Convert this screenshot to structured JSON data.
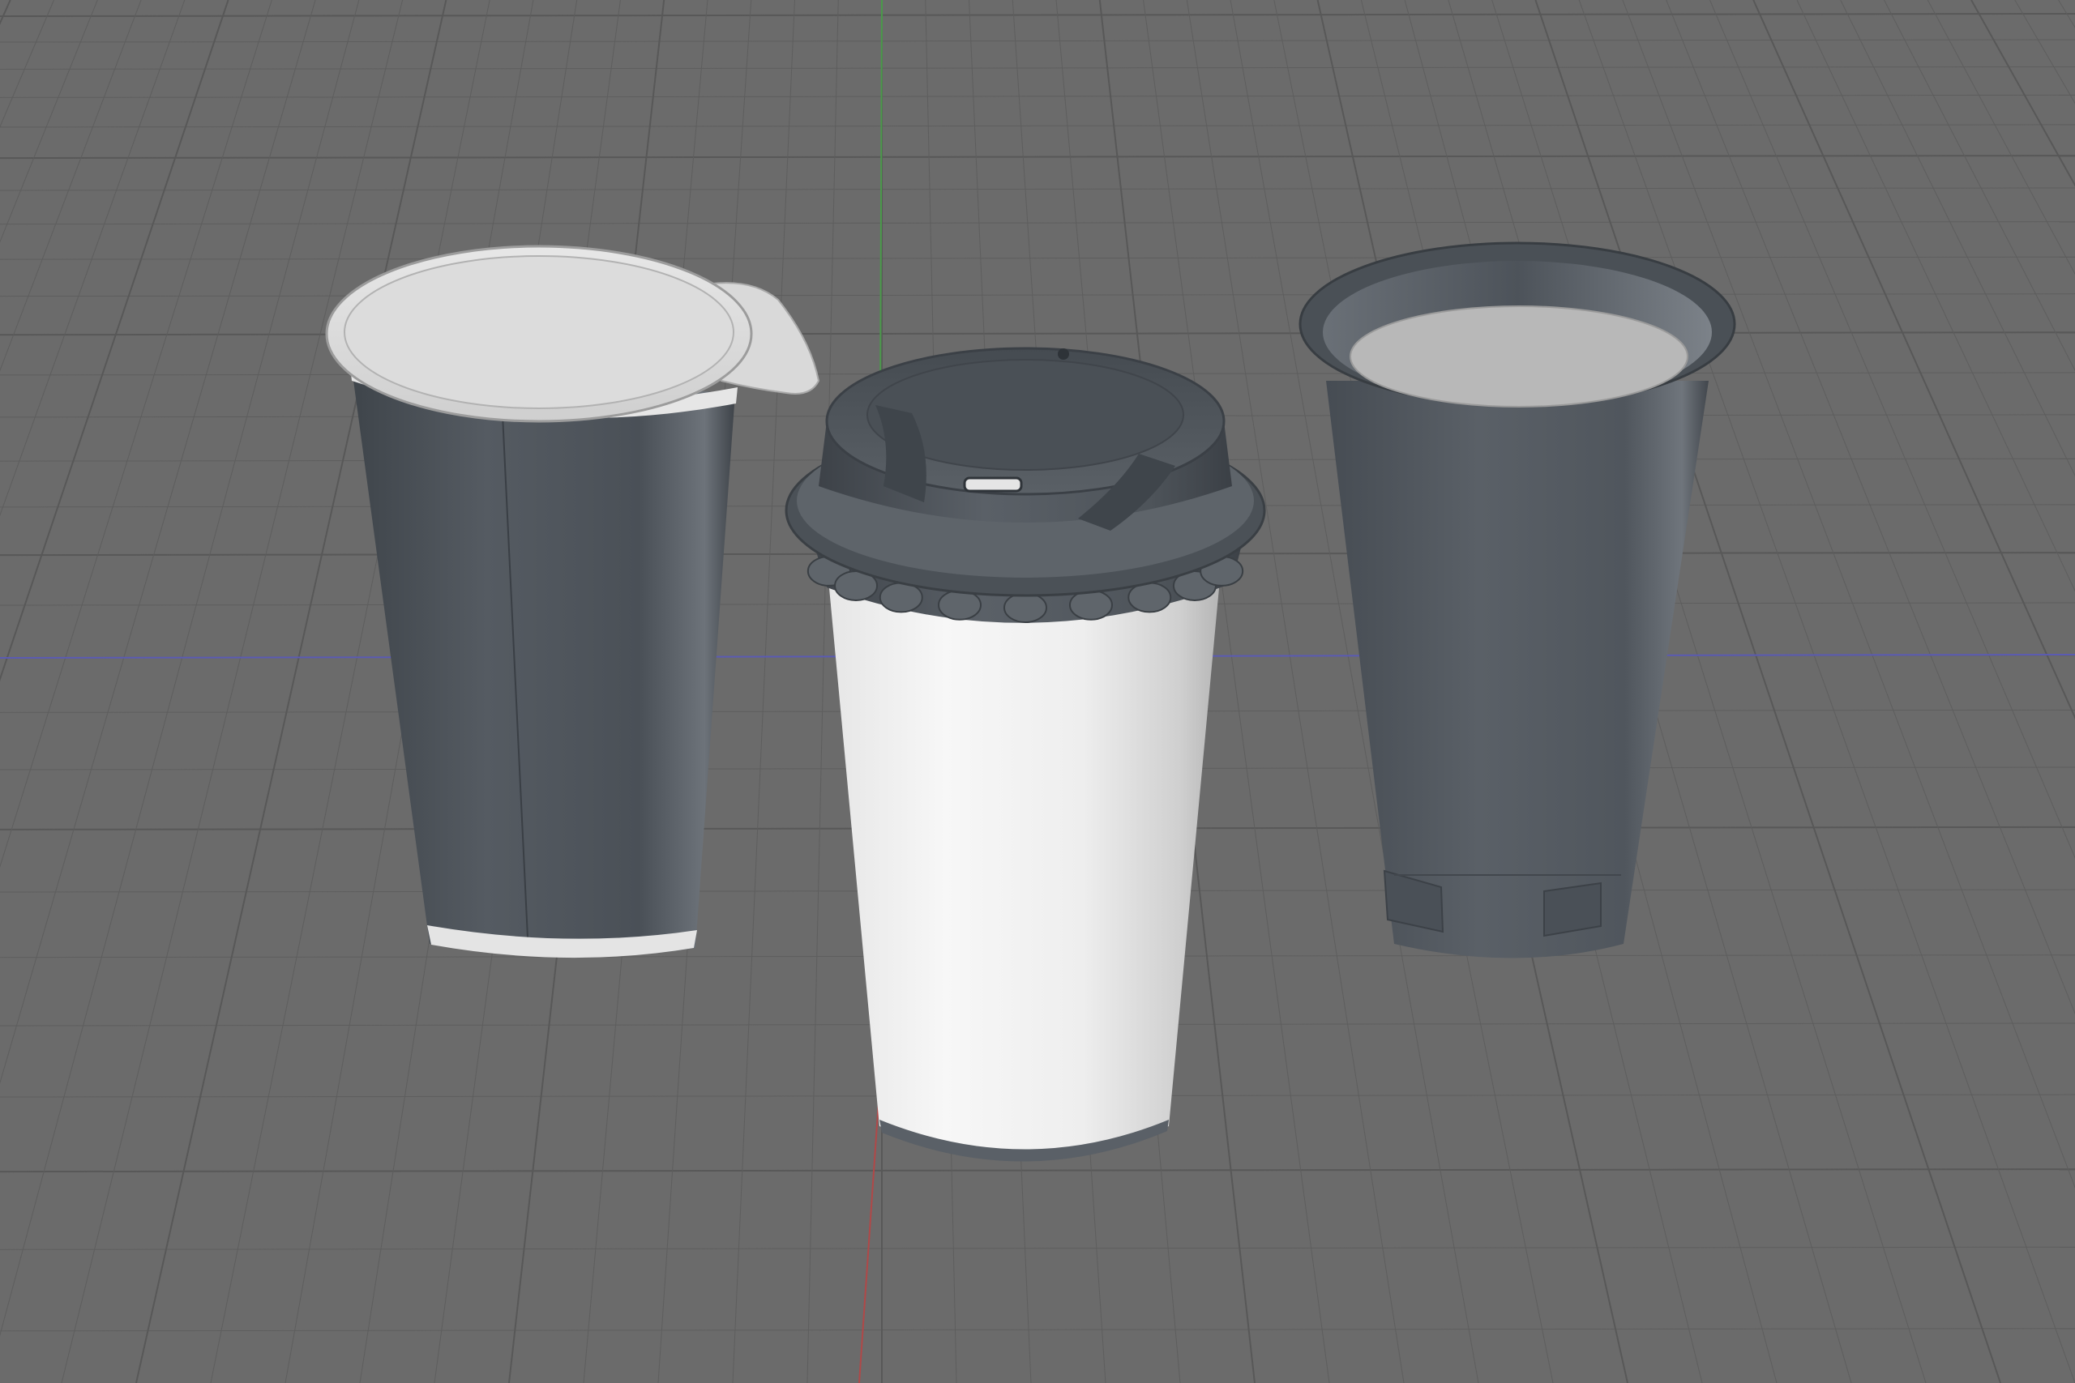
{
  "viewport": {
    "background_color": "#6b6b6b",
    "grid_color": "#5e5e5e",
    "grid_major_color": "#585858",
    "axis_x_color": "#5b5bb3",
    "axis_y_color": "#4a9a4a",
    "axis_z_color": "#b04848"
  },
  "objects": [
    {
      "name": "yogurt-cup-with-foil-lid",
      "body_color": "#4f555c",
      "lid_color": "#d9d9d9",
      "bottom_band_color": "#e4e4e4"
    },
    {
      "name": "coffee-cup-with-lid",
      "body_color": "#f1f1f1",
      "lid_color": "#4d5359"
    },
    {
      "name": "open-cup",
      "body_color": "#535960",
      "inner_floor_color": "#b8b8b8"
    }
  ]
}
